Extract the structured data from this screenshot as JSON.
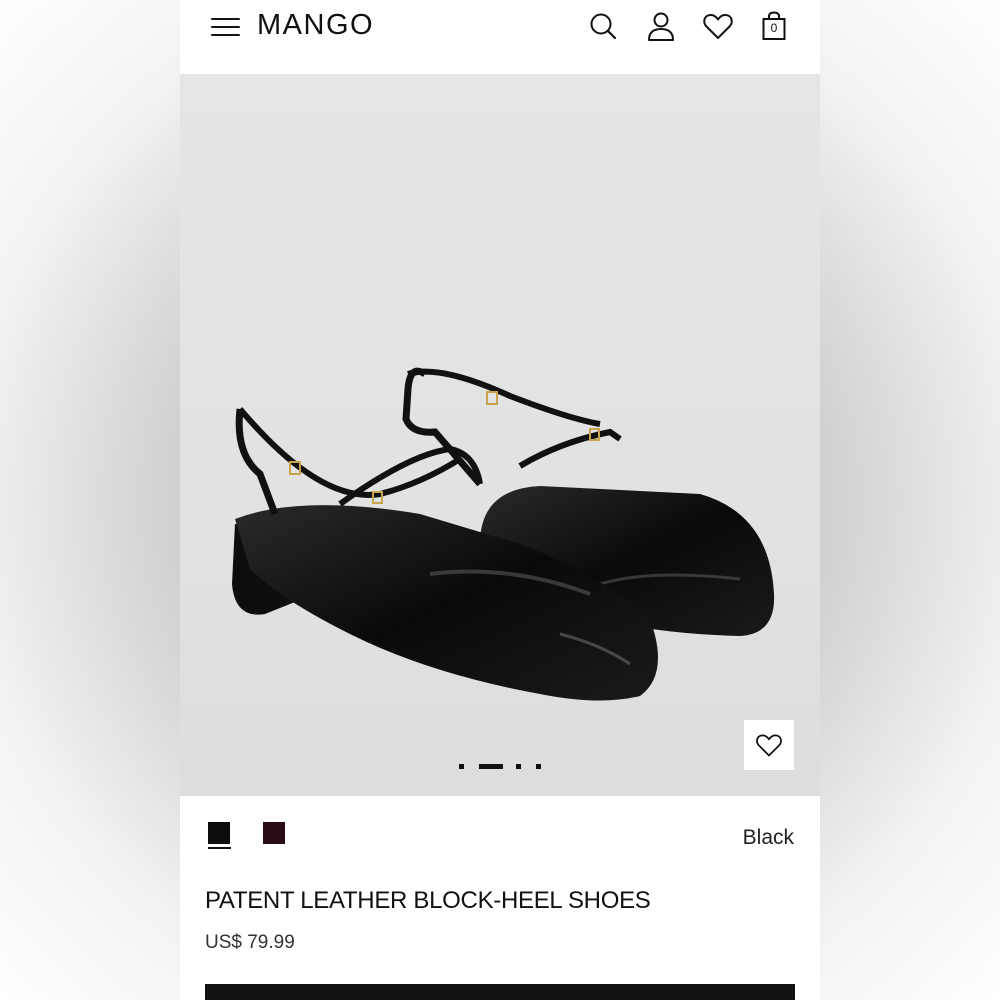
{
  "header": {
    "logo": "MANGO",
    "bag_count": "0",
    "icons": [
      "menu-icon",
      "search-icon",
      "user-icon",
      "heart-icon",
      "bag-icon"
    ]
  },
  "gallery": {
    "slide_count": 4,
    "active_slide": 2
  },
  "product": {
    "colors": [
      {
        "name": "Black",
        "hex": "#0d0d0d",
        "selected": true
      },
      {
        "name": "Burgundy",
        "hex": "#2a0c14",
        "selected": false
      }
    ],
    "selected_color_label": "Black",
    "title": "PATENT LEATHER BLOCK-HEEL SHOES",
    "price": "US$ 79.99"
  }
}
